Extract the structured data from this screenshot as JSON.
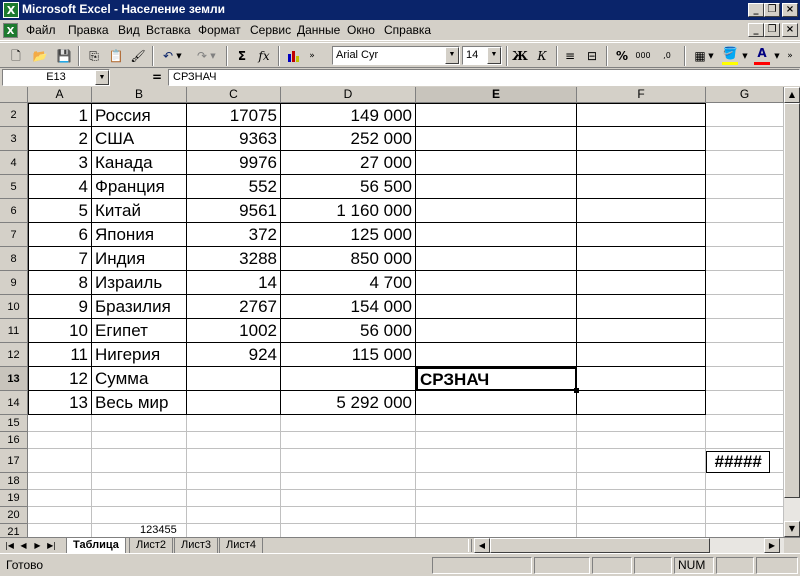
{
  "window": {
    "title": "Microsoft Excel - Население земли",
    "app_icon": "excel-icon",
    "controls": [
      "minimize-icon",
      "restore-icon",
      "close-icon"
    ]
  },
  "menu": [
    "Файл",
    "Правка",
    "Вид",
    "Вставка",
    "Формат",
    "Сервис",
    "Данные",
    "Окно",
    "Справка"
  ],
  "toolbar": {
    "font_name": "Arial Cyr",
    "font_size": "14",
    "bold_label": "Ж",
    "italic_label": "К",
    "sum_label": "Σ",
    "fx_label": "fx",
    "percent_label": "%",
    "thousands_label": "000",
    "inc_decimal_label": ",0",
    "dec_decimal_label": ",00",
    "font_color": "#ff0000",
    "fill_color": "#ffff00"
  },
  "formula_bar": {
    "name_box": "E13",
    "equals": "=",
    "formula": "СРЗНАЧ"
  },
  "columns": [
    "A",
    "B",
    "C",
    "D",
    "E",
    "F",
    "G"
  ],
  "selected_column": "E",
  "selected_row": "13",
  "rows": [
    {
      "num": "2",
      "a": "1",
      "b": "Россия",
      "c": "17075",
      "d": "149 000"
    },
    {
      "num": "3",
      "a": "2",
      "b": "США",
      "c": "9363",
      "d": "252 000"
    },
    {
      "num": "4",
      "a": "3",
      "b": "Канада",
      "c": "9976",
      "d": "27 000"
    },
    {
      "num": "5",
      "a": "4",
      "b": "Франция",
      "c": "552",
      "d": "56 500"
    },
    {
      "num": "6",
      "a": "5",
      "b": "Китай",
      "c": "9561",
      "d": "1 160 000"
    },
    {
      "num": "7",
      "a": "6",
      "b": "Япония",
      "c": "372",
      "d": "125 000"
    },
    {
      "num": "8",
      "a": "7",
      "b": "Индия",
      "c": "3288",
      "d": "850 000"
    },
    {
      "num": "9",
      "a": "8",
      "b": "Израиль",
      "c": "14",
      "d": "4 700"
    },
    {
      "num": "10",
      "a": "9",
      "b": "Бразилия",
      "c": "2767",
      "d": "154 000"
    },
    {
      "num": "11",
      "a": "10",
      "b": "Египет",
      "c": "1002",
      "d": "56 000"
    },
    {
      "num": "12",
      "a": "11",
      "b": "Нигерия",
      "c": "924",
      "d": "115 000"
    },
    {
      "num": "13",
      "a": "12",
      "b": "Сумма",
      "c": "",
      "d": "",
      "e": "СРЗНАЧ"
    },
    {
      "num": "14",
      "a": "13",
      "b": "Весь мир",
      "c": "",
      "d": "5 292 000"
    }
  ],
  "small_rows": [
    "15",
    "16",
    "17",
    "18",
    "19",
    "20",
    "21"
  ],
  "g17_value": "#####",
  "row21_text": "123455",
  "sheet_tabs": [
    "Таблица",
    "Лист2",
    "Лист3",
    "Лист4"
  ],
  "active_tab": "Таблица",
  "status": {
    "ready": "Готово",
    "num": "NUM"
  }
}
